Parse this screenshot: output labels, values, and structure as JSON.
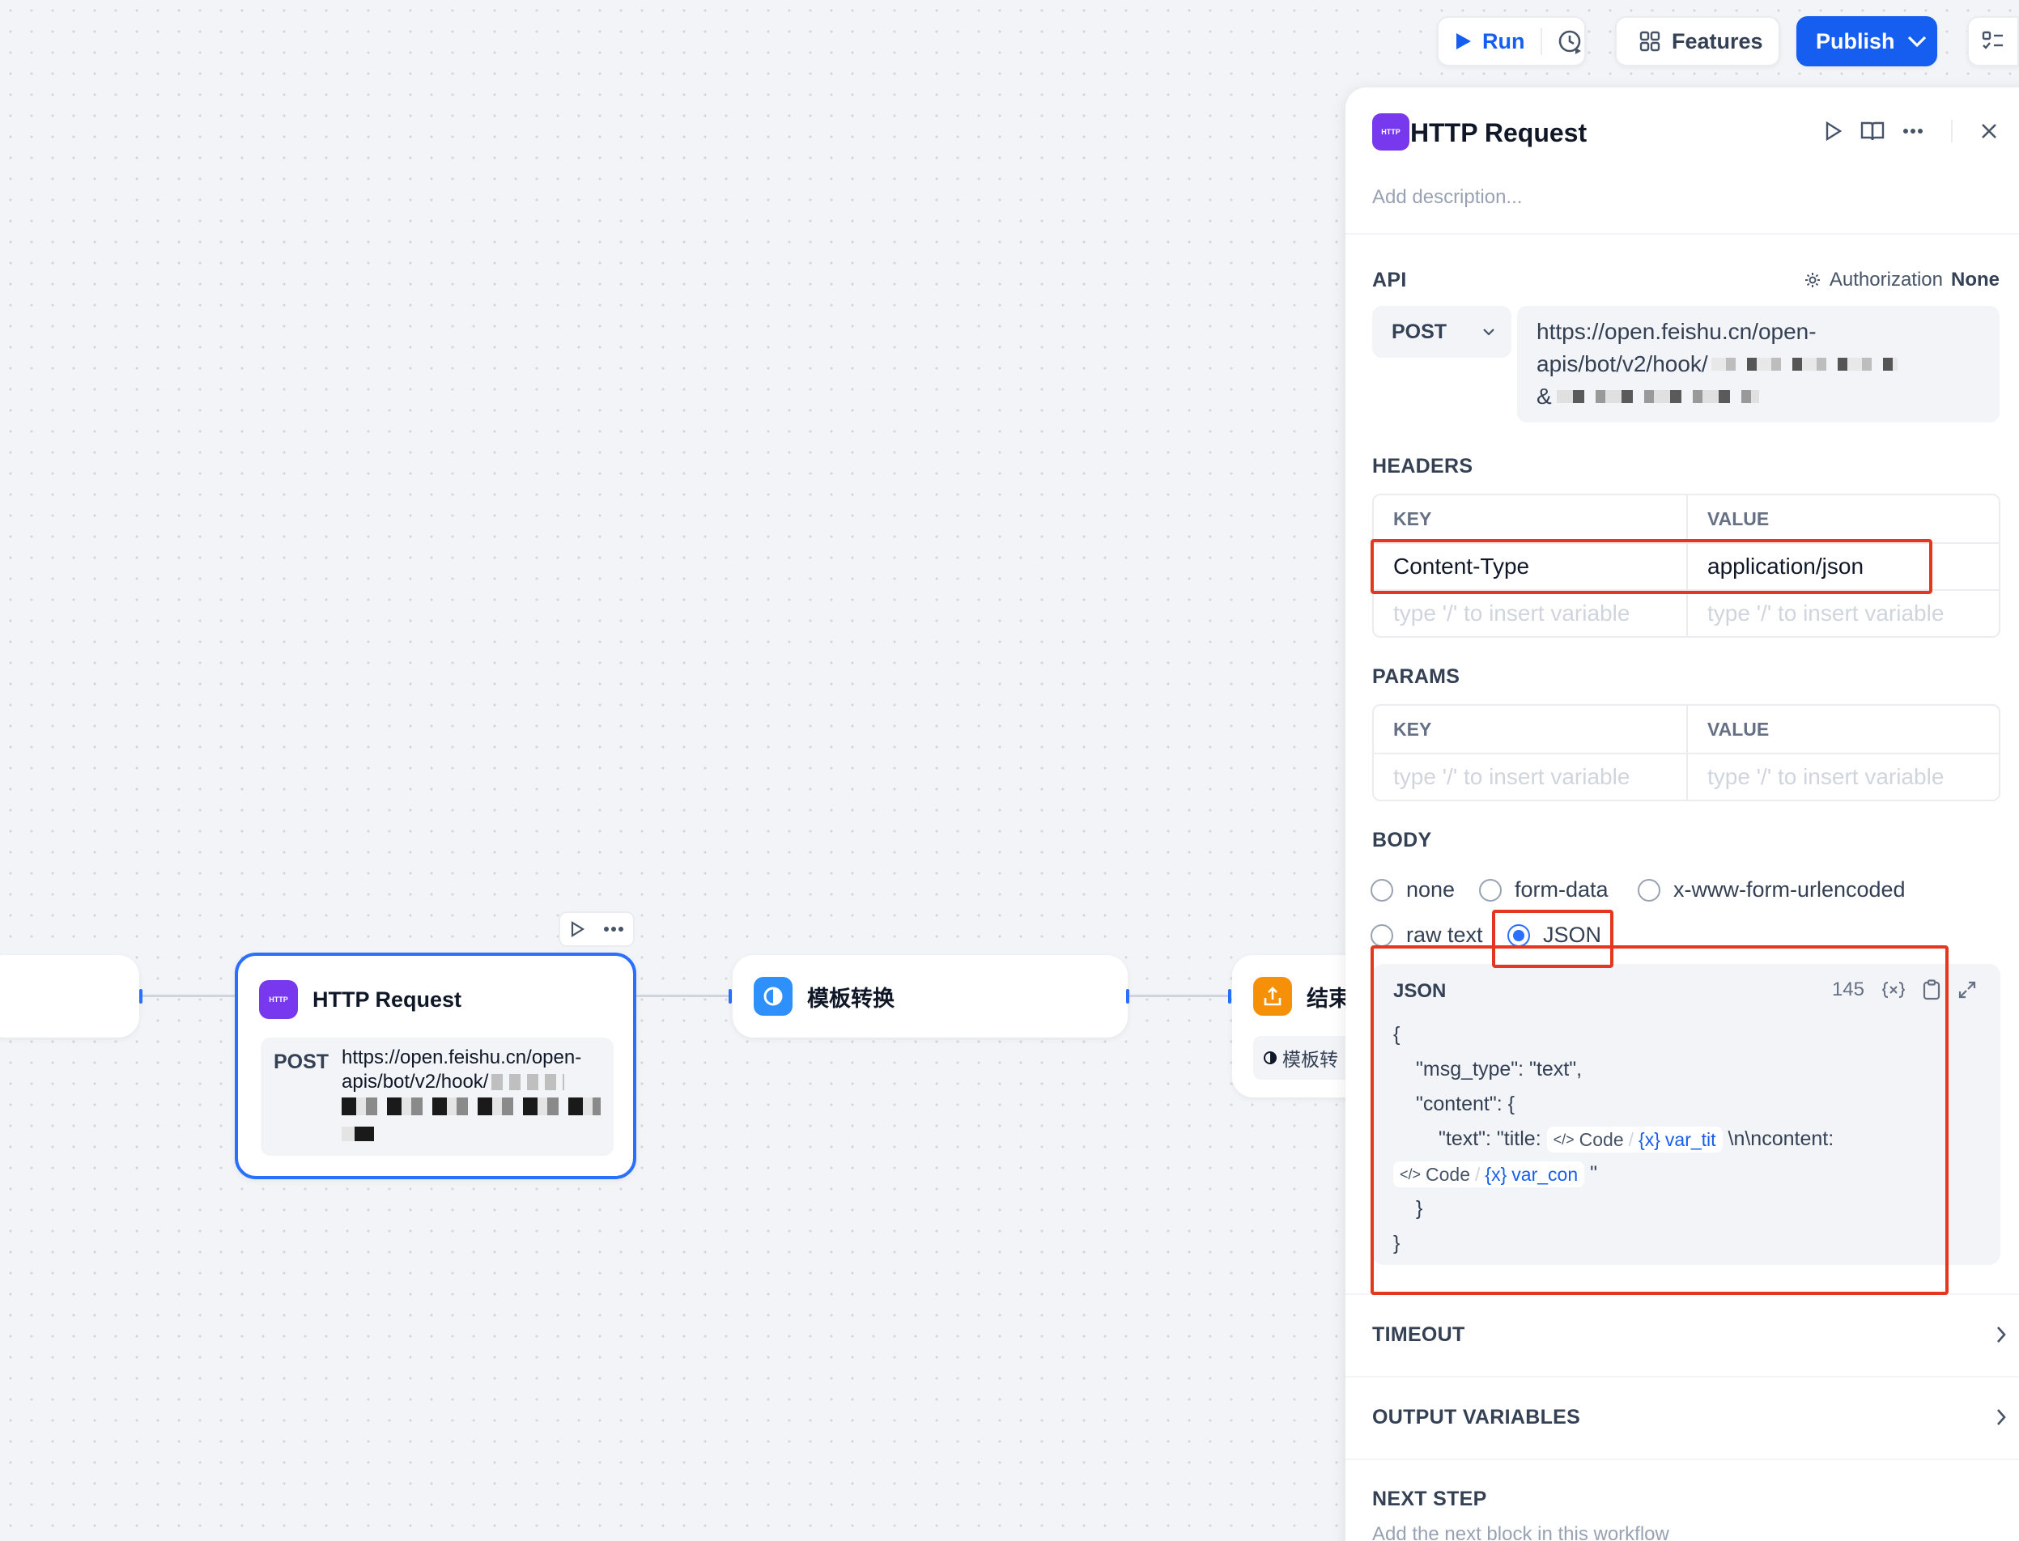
{
  "toolbar": {
    "run_label": "Run",
    "features_label": "Features",
    "publish_label": "Publish"
  },
  "canvas": {
    "http_node": {
      "icon_text": "HTTP",
      "title": "HTTP Request",
      "method": "POST",
      "url_line1": "https://open.feishu.cn/open-",
      "url_line2": "apis/bot/v2/hook/"
    },
    "template_node": {
      "title": "模板转换"
    },
    "end_node": {
      "title": "结束",
      "chip_label": "模板转"
    }
  },
  "panel": {
    "icon_text": "HTTP",
    "title": "HTTP Request",
    "description_placeholder": "Add description...",
    "api": {
      "section_label": "API",
      "authorization_label": "Authorization",
      "authorization_value": "None",
      "method": "POST",
      "url_line1": "https://open.feishu.cn/open-",
      "url_line2": "apis/bot/v2/hook/",
      "url_line3": "&"
    },
    "headers": {
      "section_label": "HEADERS",
      "col_key": "KEY",
      "col_value": "VALUE",
      "rows": [
        {
          "key": "Content-Type",
          "value": "application/json"
        }
      ],
      "placeholder": "type '/' to insert variable"
    },
    "params": {
      "section_label": "PARAMS",
      "col_key": "KEY",
      "col_value": "VALUE",
      "placeholder": "type '/' to insert variable"
    },
    "body": {
      "section_label": "BODY",
      "options": [
        "none",
        "form-data",
        "x-www-form-urlencoded",
        "raw text",
        "JSON"
      ],
      "selected": "JSON",
      "editor": {
        "label": "JSON",
        "char_count": "145",
        "line1": "{",
        "line2": "\"msg_type\": \"text\",",
        "line3": "\"content\": {",
        "line4_prefix": "\"text\": \"title:",
        "line4_suffix": "\\n\\ncontent:",
        "line6": "}",
        "line7": "}",
        "var_source": "Code",
        "var_title": "var_tit",
        "var_content": "var_con",
        "line5_suffix": "\""
      }
    },
    "timeout_label": "TIMEOUT",
    "output_variables_label": "OUTPUT VARIABLES",
    "next_step": {
      "label": "NEXT STEP",
      "description": "Add the next block in this workflow"
    }
  },
  "colors": {
    "accent": "#155eef",
    "http_icon": "#7839ee",
    "template_icon": "#2e90fa",
    "end_icon": "#f79009",
    "highlight": "#e5371f"
  }
}
